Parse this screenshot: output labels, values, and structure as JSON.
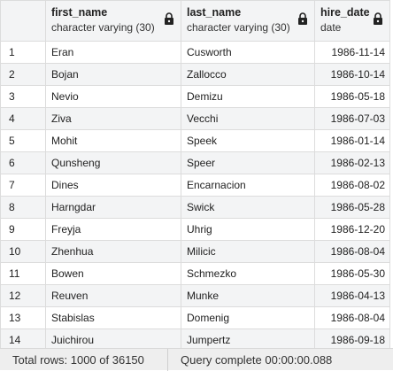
{
  "columns": [
    {
      "name": "first_name",
      "type": "character varying (30)",
      "locked": true
    },
    {
      "name": "last_name",
      "type": "character varying (30)",
      "locked": true
    },
    {
      "name": "hire_date",
      "type": "date",
      "locked": true
    }
  ],
  "rows": [
    {
      "n": "1",
      "first_name": "Eran",
      "last_name": "Cusworth",
      "hire_date": "1986-11-14"
    },
    {
      "n": "2",
      "first_name": "Bojan",
      "last_name": "Zallocco",
      "hire_date": "1986-10-14"
    },
    {
      "n": "3",
      "first_name": "Nevio",
      "last_name": "Demizu",
      "hire_date": "1986-05-18"
    },
    {
      "n": "4",
      "first_name": "Ziva",
      "last_name": "Vecchi",
      "hire_date": "1986-07-03"
    },
    {
      "n": "5",
      "first_name": "Mohit",
      "last_name": "Speek",
      "hire_date": "1986-01-14"
    },
    {
      "n": "6",
      "first_name": "Qunsheng",
      "last_name": "Speer",
      "hire_date": "1986-02-13"
    },
    {
      "n": "7",
      "first_name": "Dines",
      "last_name": "Encarnacion",
      "hire_date": "1986-08-02"
    },
    {
      "n": "8",
      "first_name": "Harngdar",
      "last_name": "Swick",
      "hire_date": "1986-05-28"
    },
    {
      "n": "9",
      "first_name": "Freyja",
      "last_name": "Uhrig",
      "hire_date": "1986-12-20"
    },
    {
      "n": "10",
      "first_name": "Zhenhua",
      "last_name": "Milicic",
      "hire_date": "1986-08-04"
    },
    {
      "n": "11",
      "first_name": "Bowen",
      "last_name": "Schmezko",
      "hire_date": "1986-05-30"
    },
    {
      "n": "12",
      "first_name": "Reuven",
      "last_name": "Munke",
      "hire_date": "1986-04-13"
    },
    {
      "n": "13",
      "first_name": "Stabislas",
      "last_name": "Domenig",
      "hire_date": "1986-08-04"
    },
    {
      "n": "14",
      "first_name": "Juichirou",
      "last_name": "Jumpertz",
      "hire_date": "1986-09-18"
    }
  ],
  "status": {
    "total_rows": "Total rows: 1000 of 36150",
    "query": "Query complete 00:00:00.088"
  },
  "icons": {
    "column_lock": "lock-icon"
  },
  "colors": {
    "header_bg": "#f3f4f5",
    "stripe_bg": "#f3f4f5",
    "grid_line": "#dcdcdc",
    "status_bg": "#eeeeee"
  }
}
